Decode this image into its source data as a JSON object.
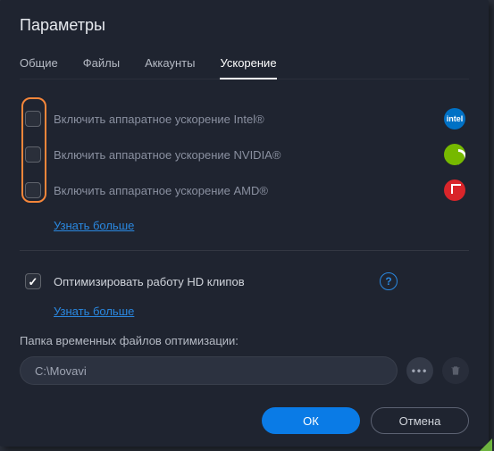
{
  "title": "Параметры",
  "tabs": [
    {
      "label": "Общие",
      "active": false
    },
    {
      "label": "Файлы",
      "active": false
    },
    {
      "label": "Аккаунты",
      "active": false
    },
    {
      "label": "Ускорение",
      "active": true
    }
  ],
  "acceleration": {
    "items": [
      {
        "label": "Включить аппаратное ускорение Intel®",
        "checked": false,
        "brand": "intel",
        "brand_text": "intel"
      },
      {
        "label": "Включить аппаратное ускорение NVIDIA®",
        "checked": false,
        "brand": "nvidia",
        "brand_text": ""
      },
      {
        "label": "Включить аппаратное ускорение AMD®",
        "checked": false,
        "brand": "amd",
        "brand_text": ""
      }
    ],
    "learn_more": "Узнать больше"
  },
  "optimize": {
    "label": "Оптимизировать работу HD клипов",
    "checked": true,
    "help": "?",
    "learn_more": "Узнать больше"
  },
  "temp_folder": {
    "label": "Папка временных файлов оптимизации:",
    "value": "C:\\Movavi"
  },
  "buttons": {
    "ok": "ОК",
    "cancel": "Отмена"
  },
  "icons": {
    "browse": "•••"
  }
}
